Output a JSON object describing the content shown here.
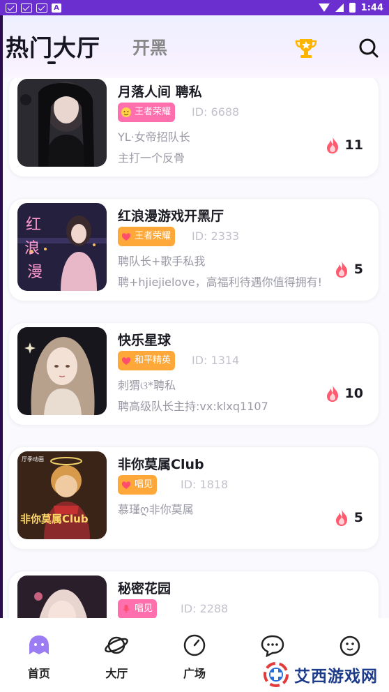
{
  "status_bar": {
    "time": "1:44",
    "left_icons": [
      "mail-icon",
      "mail-icon",
      "mail-icon",
      "a-icon"
    ]
  },
  "header": {
    "tabs": [
      {
        "label": "热门大厅",
        "active": true
      },
      {
        "label": "开黑",
        "active": false
      }
    ],
    "icons": [
      "trophy-icon",
      "search-icon"
    ]
  },
  "rooms": [
    {
      "title": "月落人间 聘私",
      "badge": "王者荣耀",
      "badge_color": "#ff6fae",
      "id": "ID: 6688",
      "desc1": "YL·女帝招队长",
      "desc2": "主打一个反骨",
      "heat": "11"
    },
    {
      "title": "红浪漫游戏开黑厅",
      "badge": "王者荣耀",
      "badge_color": "#ffa83a",
      "id": "ID: 2333",
      "desc1": "聘队长+歌手私我",
      "desc2": "聘+hjiejielove，高福利待遇你值得拥有!",
      "heat": "5"
    },
    {
      "title": "快乐星球",
      "badge": "和平精英",
      "badge_color": "#ffa83a",
      "id": "ID: 1314",
      "desc1": "刺猬ଓ*聘私",
      "desc2": "聘高级队长主持:vx:klxq1107",
      "heat": "10"
    },
    {
      "title": "非你莫属Club",
      "badge": "唱见",
      "badge_color": "#ffa83a",
      "id": "ID: 1818",
      "desc1": "慕瑾ღ非你莫属",
      "desc2": "",
      "heat": "5"
    },
    {
      "title": "秘密花园",
      "badge": "唱见",
      "badge_color": "#ff6fae",
      "id": "ID: 2288",
      "desc1": "",
      "desc2": "",
      "heat": ""
    }
  ],
  "bottom_nav": [
    {
      "label": "首页",
      "icon": "home-icon"
    },
    {
      "label": "大厅",
      "icon": "planet-icon"
    },
    {
      "label": "广场",
      "icon": "compass-icon"
    },
    {
      "label": "",
      "icon": "chat-icon"
    },
    {
      "label": "",
      "icon": "face-icon"
    }
  ],
  "watermark": {
    "text": "艾西游戏网"
  }
}
